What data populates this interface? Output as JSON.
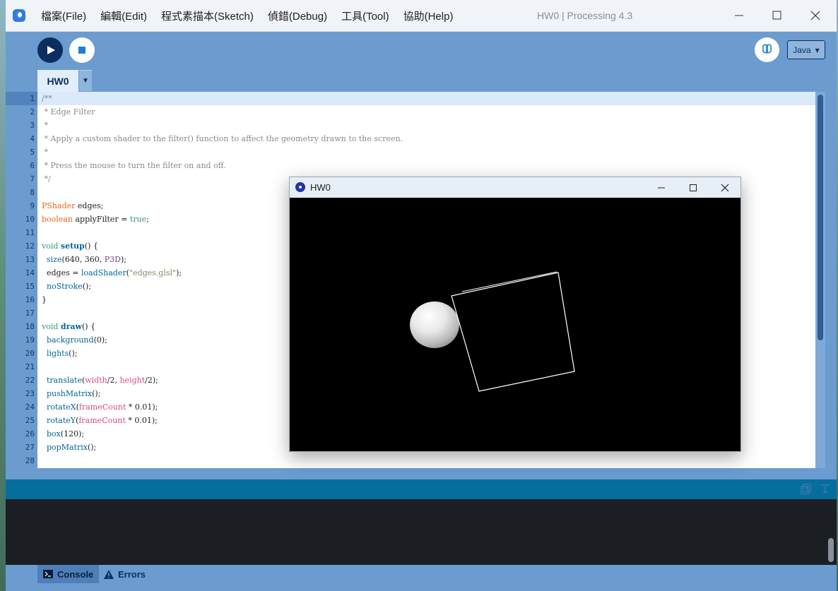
{
  "menu": [
    "檔案(File)",
    "編輯(Edit)",
    "程式素描本(Sketch)",
    "偵錯(Debug)",
    "工具(Tool)",
    "協助(Help)"
  ],
  "window_title": "HW0 | Processing 4.3",
  "mode": "Java",
  "tab_name": "HW0",
  "line_numbers": [
    "1",
    "2",
    "3",
    "4",
    "5",
    "6",
    "7",
    "8",
    "9",
    "10",
    "11",
    "12",
    "13",
    "14",
    "15",
    "16",
    "17",
    "18",
    "19",
    "20",
    "21",
    "22",
    "23",
    "24",
    "25",
    "26",
    "27",
    "28"
  ],
  "code": {
    "l1": "/**",
    "l2": " * Edge Filter",
    "l3": " *",
    "l4": " * Apply a custom shader to the filter() function to affect the geometry drawn to the screen.",
    "l5": " *",
    "l6": " * Press the mouse to turn the filter on and off.",
    "l7": " */",
    "l9_type": "PShader",
    "l9_rest": " edges;",
    "l10_type": "boolean",
    "l10_mid": " applyFilter = ",
    "l10_val": "true",
    "l10_end": ";",
    "l12_kw": "void",
    "l12_fn": "setup",
    "l12_end": "() {",
    "l13_fn": "size",
    "l13_mid": "(640, 360, ",
    "l13_const": "P3D",
    "l13_end": ");",
    "l14_a": "edges = ",
    "l14_fn": "loadShader",
    "l14_b": "(",
    "l14_str": "\"edges.glsl\"",
    "l14_end": ");",
    "l15_fn": "noStroke",
    "l15_end": "();",
    "l16": "}",
    "l18_kw": "void",
    "l18_fn": "draw",
    "l18_end": "() {",
    "l19_fn": "background",
    "l19_end": "(0);",
    "l20_fn": "lights",
    "l20_end": "();",
    "l22_fn": "translate",
    "l22_b": "(",
    "l22_var1": "width",
    "l22_c": "/2, ",
    "l22_var2": "height",
    "l22_end": "/2);",
    "l23_fn": "pushMatrix",
    "l23_end": "();",
    "l24_fn": "rotateX",
    "l24_b": "(",
    "l24_var": "frameCount",
    "l24_end": " * 0.01);",
    "l25_fn": "rotateY",
    "l25_b": "(",
    "l25_var": "frameCount",
    "l25_end": " * 0.01);",
    "l26_fn": "box",
    "l26_end": "(120);",
    "l27_fn": "popMatrix",
    "l27_end": "();"
  },
  "console_tab": "Console",
  "errors_tab": "Errors",
  "sketch_window_title": "HW0",
  "colors": {
    "accent": "#0b2e5e",
    "editor_bg": "#ffffff",
    "chrome": "#6b9bcf",
    "console_bar": "#066e9c"
  }
}
